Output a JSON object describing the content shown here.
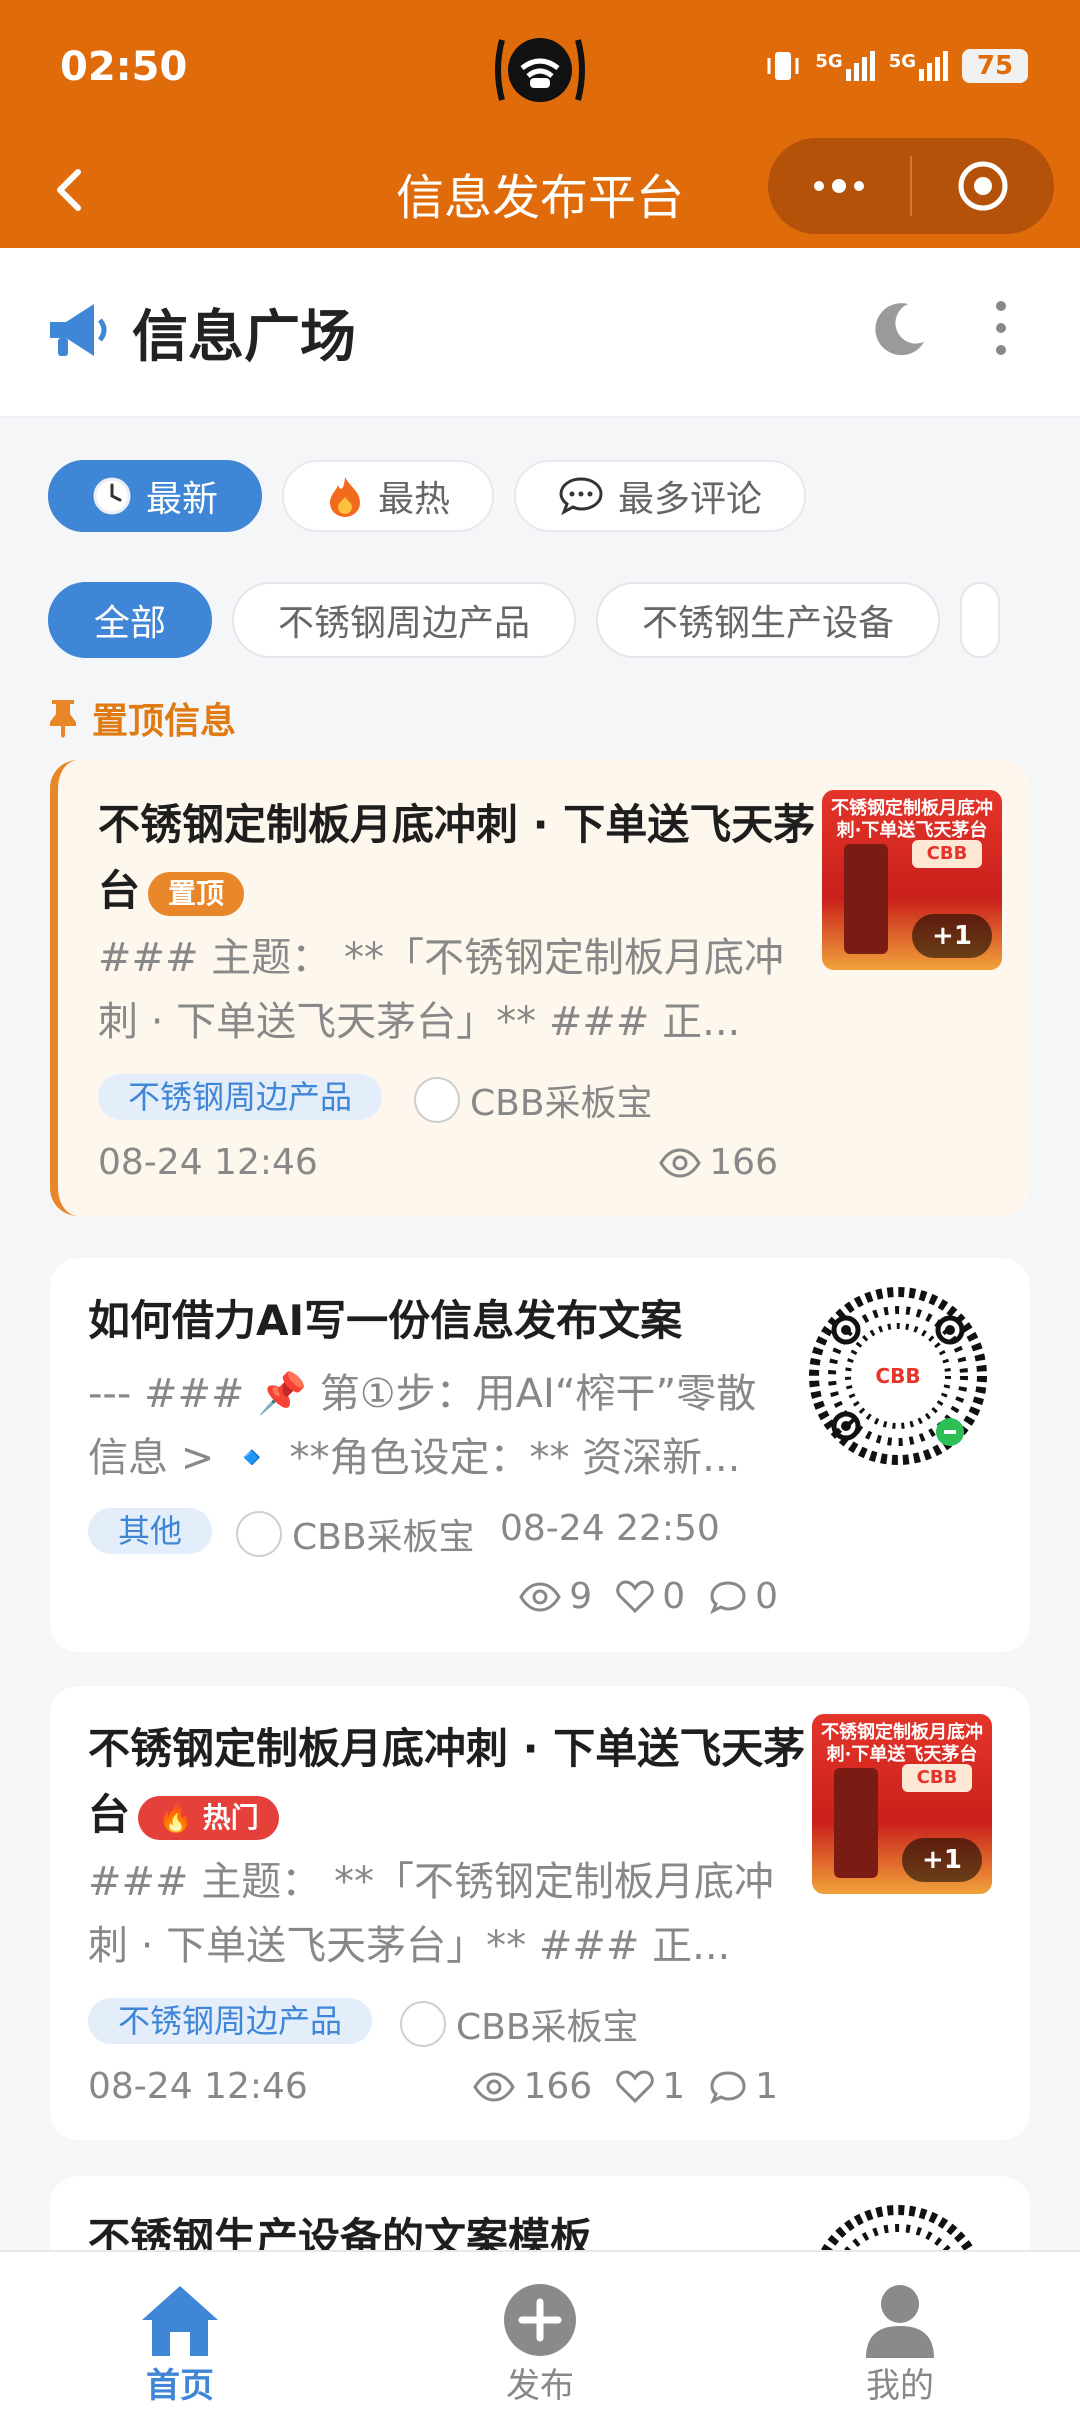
{
  "status_bar": {
    "time": "02:50",
    "battery": "75",
    "signal1": "5G",
    "signal2": "5G"
  },
  "navbar": {
    "title": "信息发布平台"
  },
  "header": {
    "title": "信息广场"
  },
  "sort_tabs": [
    {
      "label": "最新",
      "icon": "clock-icon",
      "active": true
    },
    {
      "label": "最热",
      "icon": "fire-icon",
      "active": false
    },
    {
      "label": "最多评论",
      "icon": "speech-bubble-icon",
      "active": false
    }
  ],
  "categories": [
    {
      "label": "全部",
      "active": true
    },
    {
      "label": "不锈钢周边产品",
      "active": false
    },
    {
      "label": "不锈钢生产设备",
      "active": false
    }
  ],
  "pinned_section": {
    "label": "置顶信息"
  },
  "posts": [
    {
      "title": "不锈钢定制板月底冲刺 · 下单送飞天茅台",
      "badge": "置顶",
      "summary": "### 主题： **「不锈钢定制板月底冲刺 · 下单送飞天茅台」** ### 正...",
      "tag": "不锈钢周边产品",
      "author": "CBB采板宝",
      "date": "08-24 12:46",
      "views": "166",
      "thumb": {
        "title": "不锈钢定制板月底冲刺·下单送飞天茅台",
        "logo": "CBB",
        "extra": "+1"
      }
    },
    {
      "title": "如何借力AI写一份信息发布文案",
      "summary": "--- ### 📌 第①步：用AI“榨干”零散信息 > 🔹 **角色设定：** 资深新...",
      "tag": "其他",
      "author": "CBB采板宝",
      "date": "08-24 22:50",
      "views": "9",
      "likes": "0",
      "comments": "0",
      "thumb": {
        "logo": "CBB"
      }
    },
    {
      "title": "不锈钢定制板月底冲刺 · 下单送飞天茅台",
      "badge": "🔥 热门",
      "summary": "### 主题： **「不锈钢定制板月底冲刺 · 下单送飞天茅台」** ### 正...",
      "tag": "不锈钢周边产品",
      "author": "CBB采板宝",
      "date": "08-24 12:46",
      "views": "166",
      "likes": "1",
      "comments": "1",
      "thumb": {
        "title": "不锈钢定制板月底冲刺·下单送飞天茅台",
        "logo": "CBB",
        "extra": "+1"
      }
    },
    {
      "title": "不锈钢生产设备的文案模板"
    }
  ],
  "bottom_nav": [
    {
      "label": "首页",
      "icon": "home-icon",
      "active": true
    },
    {
      "label": "发布",
      "icon": "plus-circle-icon",
      "active": false
    },
    {
      "label": "我的",
      "icon": "user-icon",
      "active": false
    }
  ],
  "colors": {
    "brand_orange": "#e06b0a",
    "accent_blue": "#3f86d6",
    "hot_red": "#e5413a",
    "pinned_bg": "#fdf7ee"
  }
}
